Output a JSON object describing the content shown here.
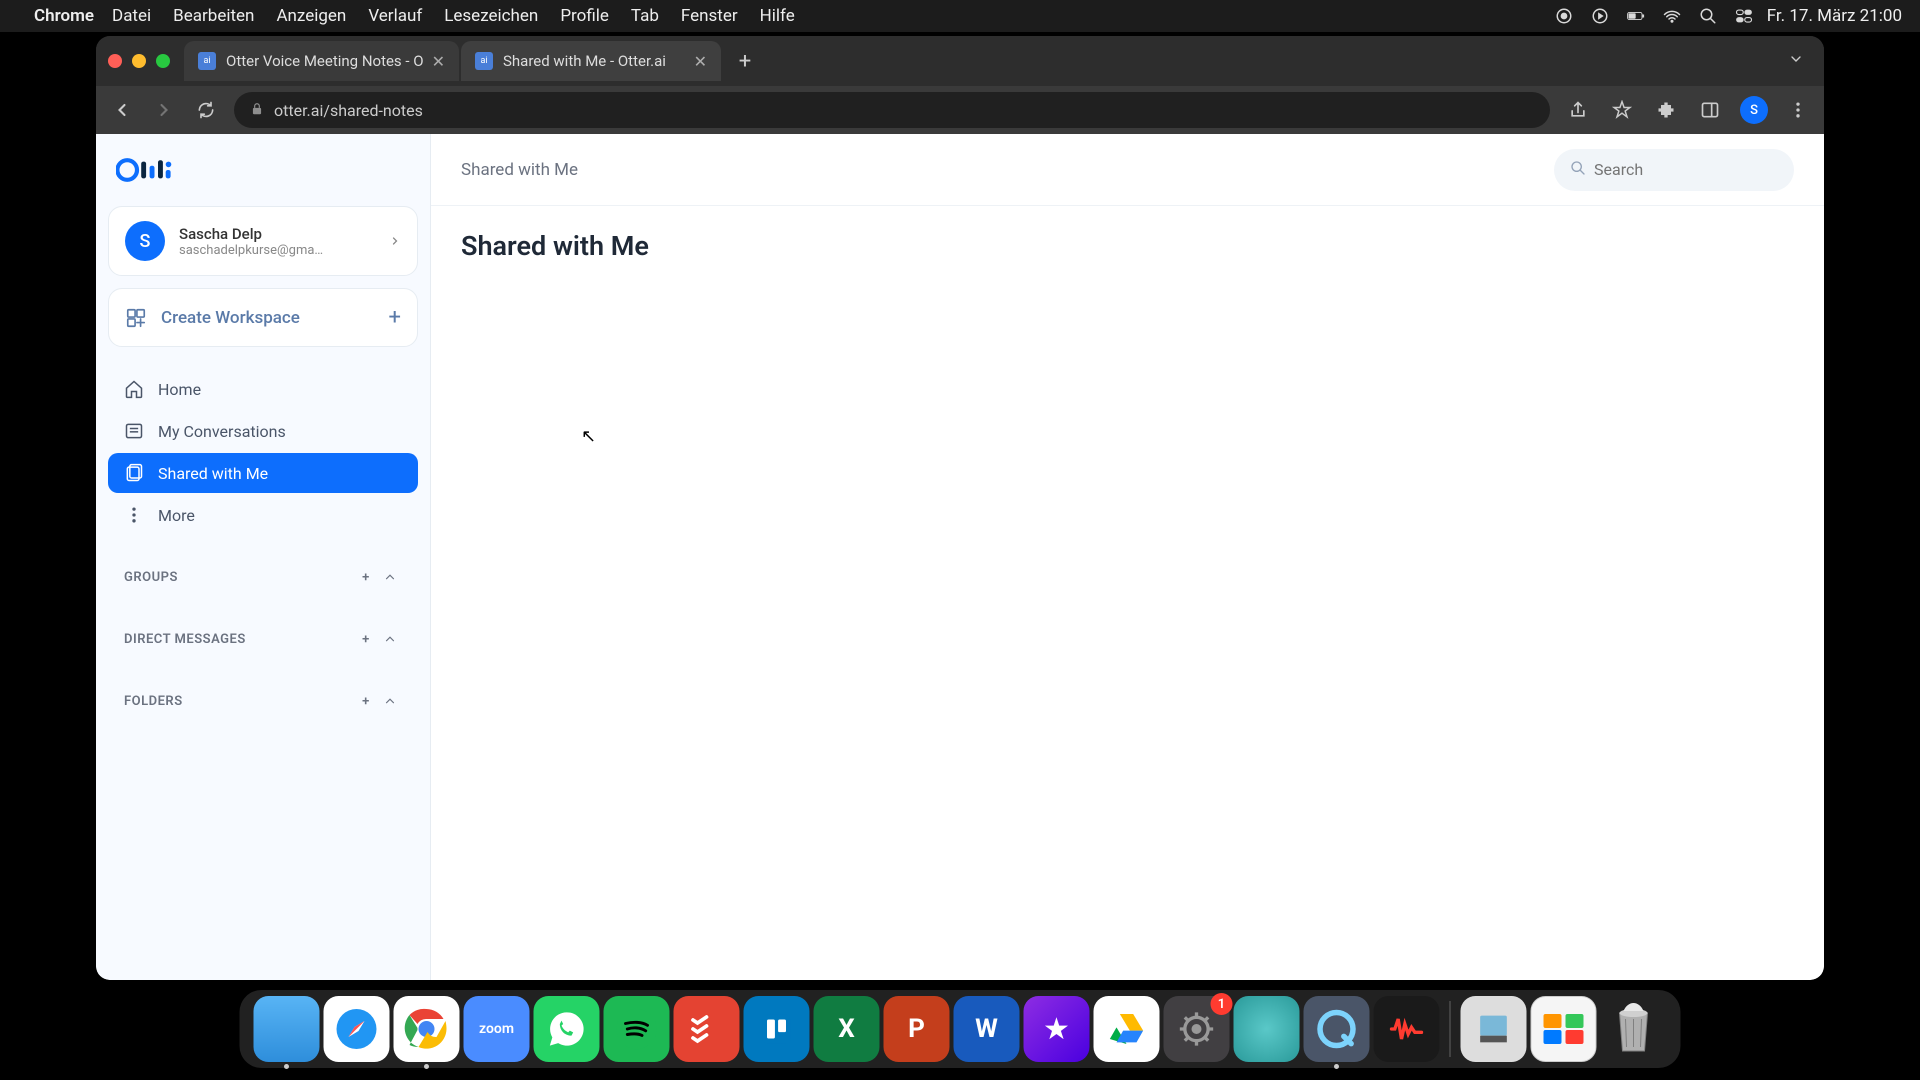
{
  "menubar": {
    "appname": "Chrome",
    "items": [
      "Datei",
      "Bearbeiten",
      "Anzeigen",
      "Verlauf",
      "Lesezeichen",
      "Profile",
      "Tab",
      "Fenster",
      "Hilfe"
    ],
    "datetime": "Fr. 17. März  21:00"
  },
  "tabs": [
    {
      "title": "Otter Voice Meeting Notes - O",
      "active": false
    },
    {
      "title": "Shared with Me - Otter.ai",
      "active": true
    }
  ],
  "url": "otter.ai/shared-notes",
  "account": {
    "initial": "S",
    "name": "Sascha Delp",
    "email": "saschadelpkurse@gma…"
  },
  "workspace": {
    "label": "Create Workspace"
  },
  "nav": {
    "home": "Home",
    "myconv": "My Conversations",
    "shared": "Shared with Me",
    "more": "More"
  },
  "sections": {
    "groups": "GROUPS",
    "dm": "DIRECT MESSAGES",
    "folders": "FOLDERS"
  },
  "header": {
    "breadcrumb": "Shared with Me",
    "search_placeholder": "Search"
  },
  "page": {
    "title": "Shared with Me"
  },
  "dock": {
    "settings_badge": "1"
  },
  "avatar_initial": "S"
}
